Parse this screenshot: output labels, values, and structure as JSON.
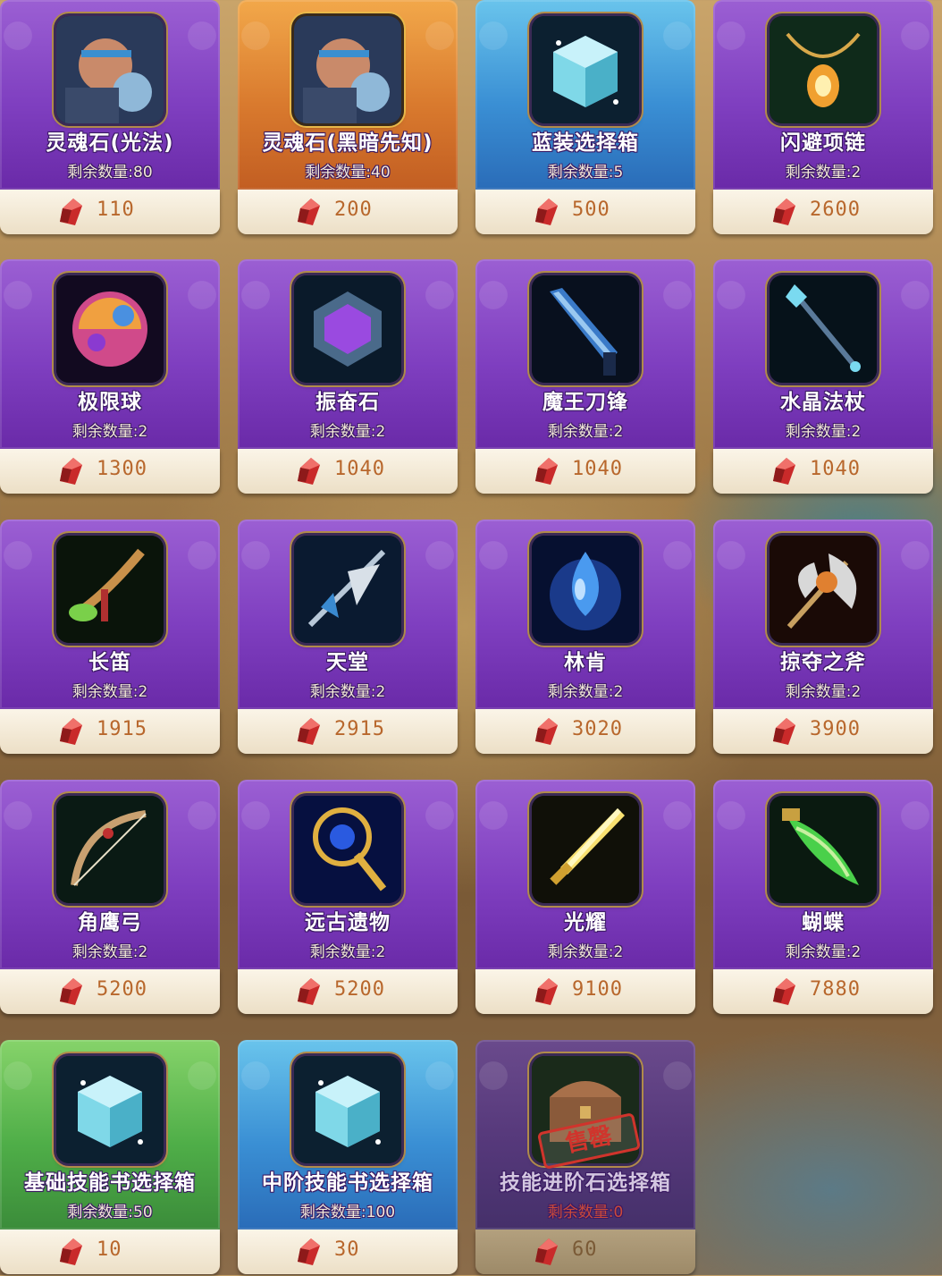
{
  "shop": {
    "items": [
      {
        "name": "灵魂石(光法)",
        "remaining": "剩余数量:80",
        "price": "110",
        "theme": "purple",
        "icon": "hero-portrait-icon"
      },
      {
        "name": "灵魂石(黑暗先知)",
        "remaining": "剩余数量:40",
        "price": "200",
        "theme": "orange",
        "icon": "hero-portrait-icon"
      },
      {
        "name": "蓝装选择箱",
        "remaining": "剩余数量:5",
        "price": "500",
        "theme": "blue",
        "icon": "chest-icon"
      },
      {
        "name": "闪避项链",
        "remaining": "剩余数量:2",
        "price": "2600",
        "theme": "purple",
        "icon": "necklace-icon"
      },
      {
        "name": "极限球",
        "remaining": "剩余数量:2",
        "price": "1300",
        "theme": "purple",
        "icon": "orb-icon"
      },
      {
        "name": "振奋石",
        "remaining": "剩余数量:2",
        "price": "1040",
        "theme": "purple",
        "icon": "gem-stone-icon"
      },
      {
        "name": "魔王刀锋",
        "remaining": "剩余数量:2",
        "price": "1040",
        "theme": "purple",
        "icon": "blade-icon"
      },
      {
        "name": "水晶法杖",
        "remaining": "剩余数量:2",
        "price": "1040",
        "theme": "purple",
        "icon": "staff-icon"
      },
      {
        "name": "长笛",
        "remaining": "剩余数量:2",
        "price": "1915",
        "theme": "purple",
        "icon": "flute-icon"
      },
      {
        "name": "天堂",
        "remaining": "剩余数量:2",
        "price": "2915",
        "theme": "purple",
        "icon": "halberd-icon"
      },
      {
        "name": "林肯",
        "remaining": "剩余数量:2",
        "price": "3020",
        "theme": "purple",
        "icon": "droplet-icon"
      },
      {
        "name": "掠夺之斧",
        "remaining": "剩余数量:2",
        "price": "3900",
        "theme": "purple",
        "icon": "axe-icon"
      },
      {
        "name": "角鹰弓",
        "remaining": "剩余数量:2",
        "price": "5200",
        "theme": "purple",
        "icon": "bow-icon"
      },
      {
        "name": "远古遗物",
        "remaining": "剩余数量:2",
        "price": "5200",
        "theme": "purple",
        "icon": "scepter-icon"
      },
      {
        "name": "光耀",
        "remaining": "剩余数量:2",
        "price": "9100",
        "theme": "purple",
        "icon": "sword-icon"
      },
      {
        "name": "蝴蝶",
        "remaining": "剩余数量:2",
        "price": "7880",
        "theme": "purple",
        "icon": "butterfly-blade-icon"
      },
      {
        "name": "基础技能书选择箱",
        "remaining": "剩余数量:50",
        "price": "10",
        "theme": "green",
        "icon": "chest-icon"
      },
      {
        "name": "中阶技能书选择箱",
        "remaining": "剩余数量:100",
        "price": "30",
        "theme": "blue",
        "icon": "chest-icon"
      },
      {
        "name": "技能进阶石选择箱",
        "remaining": "剩余数量:0",
        "price": "60",
        "theme": "soldout",
        "icon": "treasure-chest-icon",
        "stamp": "售罄"
      }
    ]
  },
  "colors": {
    "purple_card": "#7f3fc0",
    "orange_card": "#d97a2e",
    "blue_card": "#3a8fd4",
    "green_card": "#4fae48",
    "soldout_card": "#55387a",
    "price_text": "#b8672c",
    "gem_red": "#d0342c",
    "soldout_stamp": "#d0342c"
  }
}
